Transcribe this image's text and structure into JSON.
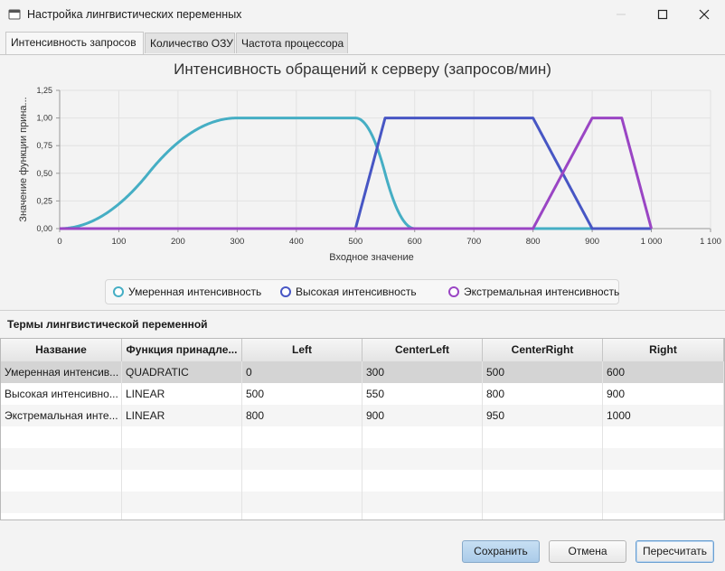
{
  "window": {
    "title": "Настройка лингвистических переменных"
  },
  "tabs": [
    {
      "label": "Интенсивность запросов",
      "active": true
    },
    {
      "label": "Количество ОЗУ",
      "active": false
    },
    {
      "label": "Частота процессора",
      "active": false
    }
  ],
  "chart_data": {
    "type": "line",
    "title": "Интенсивность обращений к серверу (запросов/мин)",
    "xlabel": "Входное значение",
    "ylabel": "Значение функции прина...",
    "xlim": [
      0,
      1100
    ],
    "ylim": [
      0,
      1.25
    ],
    "x_ticks": [
      "0",
      "100",
      "200",
      "300",
      "400",
      "500",
      "600",
      "700",
      "800",
      "900",
      "1 000",
      "1 100"
    ],
    "y_ticks": [
      "0,00",
      "0,25",
      "0,50",
      "0,75",
      "1,00",
      "1,25"
    ],
    "grid": true,
    "legend_position": "bottom",
    "series": [
      {
        "name": "Умеренная интенсивность",
        "color": "#45aec4",
        "shape": "quadratic",
        "points": [
          0,
          300,
          500,
          600
        ]
      },
      {
        "name": "Высокая интенсивность",
        "color": "#4756c4",
        "shape": "linear",
        "points": [
          500,
          550,
          800,
          900
        ]
      },
      {
        "name": "Экстремальная интенсивность",
        "color": "#9a45c4",
        "shape": "linear",
        "points": [
          800,
          900,
          950,
          1000
        ]
      }
    ]
  },
  "terms": {
    "label": "Термы лингвистической переменной",
    "columns": [
      "Название",
      "Функция принадле...",
      "Left",
      "CenterLeft",
      "CenterRight",
      "Right"
    ],
    "rows": [
      [
        "Умеренная интенсив...",
        "QUADRATIC",
        "0",
        "300",
        "500",
        "600"
      ],
      [
        "Высокая интенсивно...",
        "LINEAR",
        "500",
        "550",
        "800",
        "900"
      ],
      [
        "Экстремальная инте...",
        "LINEAR",
        "800",
        "900",
        "950",
        "1000"
      ]
    ],
    "selected_row": 0
  },
  "buttons": {
    "save": "Сохранить",
    "cancel": "Отмена",
    "recalc": "Пересчитать"
  }
}
